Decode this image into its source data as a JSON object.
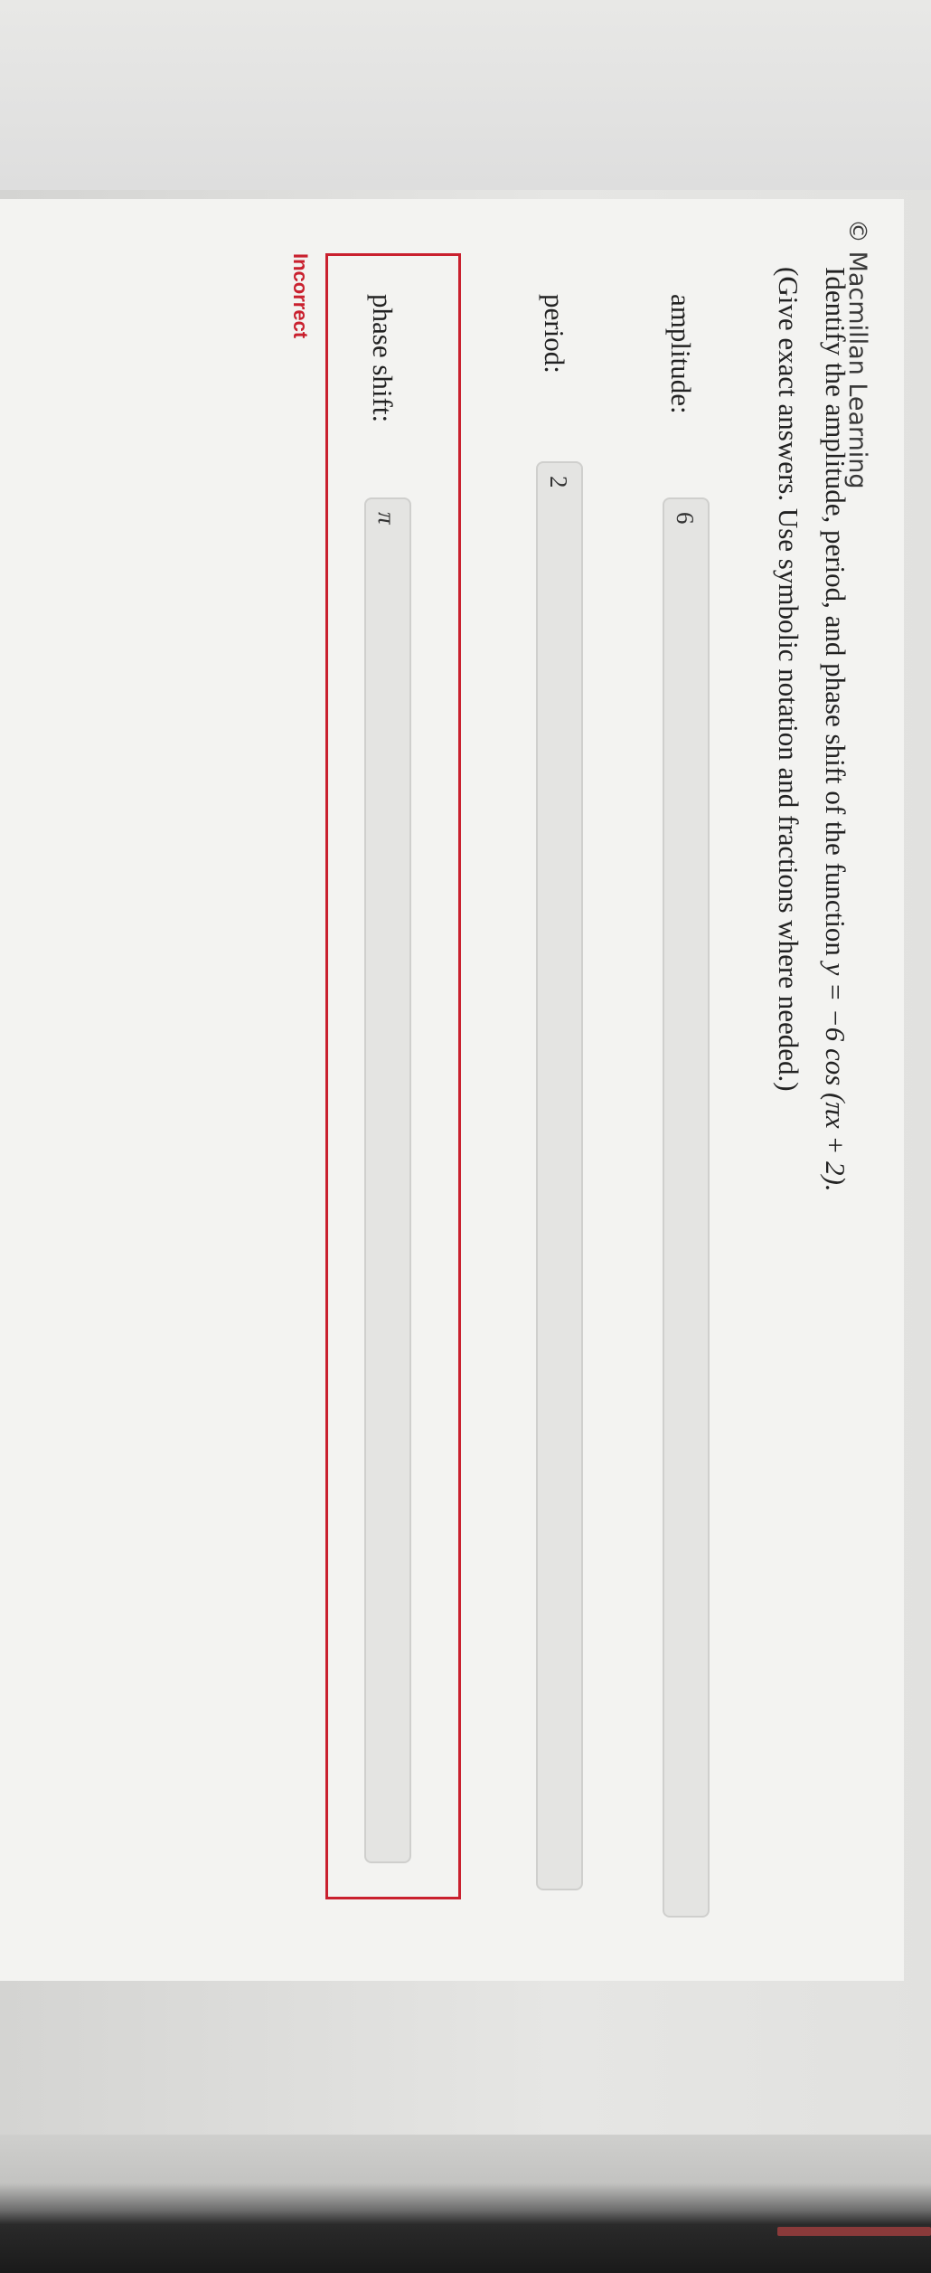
{
  "brand": {
    "copyright": "© Macmillan Learning"
  },
  "question": {
    "text_prefix": "Identify the amplitude, period, and phase shift of the function ",
    "function": "y = −6 cos (πx + 2).",
    "instructions": "(Give exact answers. Use symbolic notation and fractions where needed.)"
  },
  "fields": {
    "amplitude": {
      "label": "amplitude:",
      "value": "6"
    },
    "period": {
      "label": "period:",
      "value": "2"
    },
    "phase_shift": {
      "label": "phase shift:",
      "value": "π"
    }
  },
  "feedback": {
    "status": "Incorrect",
    "error_color": "#c9202e"
  }
}
